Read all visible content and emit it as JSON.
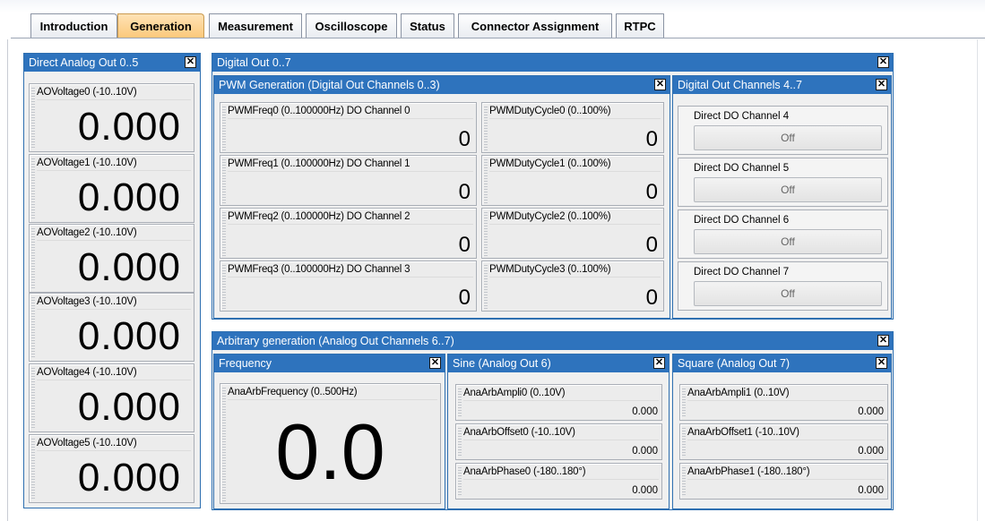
{
  "tabs": [
    {
      "label": "Introduction"
    },
    {
      "label": "Generation",
      "active": true
    },
    {
      "label": "Measurement"
    },
    {
      "label": "Oscilloscope"
    },
    {
      "label": "Status"
    },
    {
      "label": "Connector Assignment"
    },
    {
      "label": "RTPC"
    }
  ],
  "close_glyph": "✕",
  "colors": {
    "title_bar": "#2e73bd",
    "active_tab": "#fbc879"
  },
  "direct_analog": {
    "title": "Direct Analog Out 0..5",
    "channels": [
      {
        "label": "AOVoltage0 (-10..10V)",
        "value": "0.000"
      },
      {
        "label": "AOVoltage1 (-10..10V)",
        "value": "0.000"
      },
      {
        "label": "AOVoltage2 (-10..10V)",
        "value": "0.000"
      },
      {
        "label": "AOVoltage3 (-10..10V)",
        "value": "0.000"
      },
      {
        "label": "AOVoltage4 (-10..10V)",
        "value": "0.000"
      },
      {
        "label": "AOVoltage5 (-10..10V)",
        "value": "0.000"
      }
    ]
  },
  "digital_out": {
    "title": "Digital Out 0..7",
    "pwm": {
      "title": "PWM Generation (Digital Out Channels 0..3)",
      "freq": [
        {
          "label": "PWMFreq0 (0..100000Hz) DO Channel 0",
          "value": "0"
        },
        {
          "label": "PWMFreq1 (0..100000Hz) DO Channel 1",
          "value": "0"
        },
        {
          "label": "PWMFreq2 (0..100000Hz) DO Channel 2",
          "value": "0"
        },
        {
          "label": "PWMFreq3 (0..100000Hz) DO Channel 3",
          "value": "0"
        }
      ],
      "duty": [
        {
          "label": "PWMDutyCycle0 (0..100%)",
          "value": "0"
        },
        {
          "label": "PWMDutyCycle1 (0..100%)",
          "value": "0"
        },
        {
          "label": "PWMDutyCycle2 (0..100%)",
          "value": "0"
        },
        {
          "label": "PWMDutyCycle3 (0..100%)",
          "value": "0"
        }
      ]
    },
    "direct": {
      "title": "Digital Out Channels 4..7",
      "channels": [
        {
          "label": "Direct DO Channel 4",
          "state": "Off"
        },
        {
          "label": "Direct DO Channel 5",
          "state": "Off"
        },
        {
          "label": "Direct DO Channel 6",
          "state": "Off"
        },
        {
          "label": "Direct DO Channel 7",
          "state": "Off"
        }
      ]
    }
  },
  "arbitrary": {
    "title": "Arbitrary generation (Analog Out Channels 6..7)",
    "frequency": {
      "title": "Frequency",
      "label": "AnaArbFrequency (0..500Hz)",
      "value": "0.0"
    },
    "sine": {
      "title": "Sine (Analog Out 6)",
      "fields": [
        {
          "label": "AnaArbAmpli0 (0..10V)",
          "value": "0.000"
        },
        {
          "label": "AnaArbOffset0 (-10..10V)",
          "value": "0.000"
        },
        {
          "label": "AnaArbPhase0 (-180..180°)",
          "value": "0.000"
        }
      ]
    },
    "square": {
      "title": "Square (Analog Out 7)",
      "fields": [
        {
          "label": "AnaArbAmpli1 (0..10V)",
          "value": "0.000"
        },
        {
          "label": "AnaArbOffset1 (-10..10V)",
          "value": "0.000"
        },
        {
          "label": "AnaArbPhase1 (-180..180°)",
          "value": "0.000"
        }
      ]
    }
  }
}
